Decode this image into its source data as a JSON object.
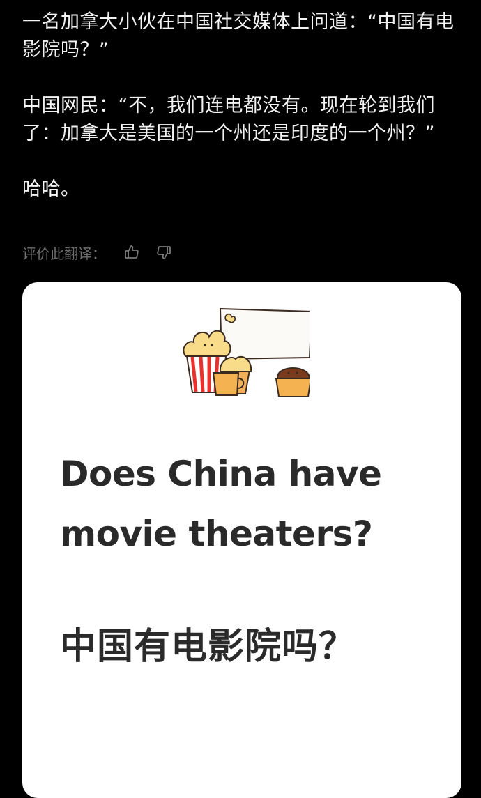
{
  "post": {
    "line1": "一名加拿大小伙在中国社交媒体上问道：“中国有电影院吗？”",
    "line2": "中国网民：“不，我们连电都没有。现在轮到我们了：加拿大是美国的一个州还是印度的一个州？”",
    "line3": "哈哈。"
  },
  "translation_rating": {
    "label": "评价此翻译：",
    "thumbs_up_icon": "thumbs-up-icon",
    "thumbs_down_icon": "thumbs-down-icon"
  },
  "card": {
    "illustration_icon": "popcorn-and-cups-illustration",
    "en_question": "Does China have movie theaters?",
    "zh_question": "中国有电影院吗？"
  }
}
